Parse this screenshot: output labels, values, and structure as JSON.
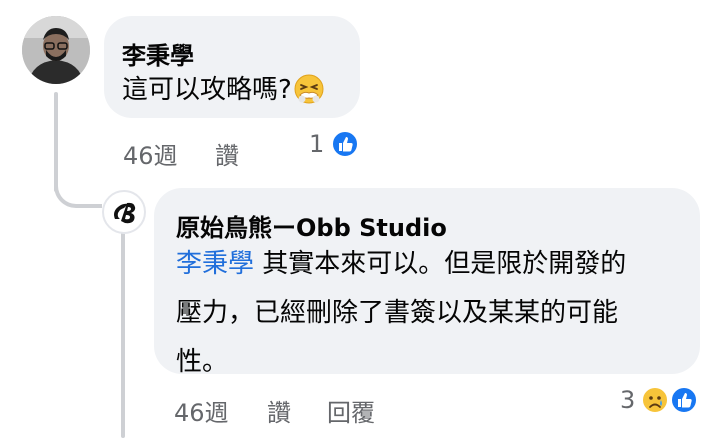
{
  "comment1": {
    "author": "李秉學",
    "text": "這可以攻略嗎?",
    "emoji": "tired-face-emoji",
    "time": "46週",
    "like_label": "讚",
    "reaction_count": "1",
    "reaction_icon": "like-icon"
  },
  "reply1": {
    "author": "原始鳥熊ーObb Studio",
    "mention": "李秉學",
    "text_line1": " 其實本來可以。但是限於開發的",
    "text_line2": "壓力，已經刪除了書簽以及某某的可能",
    "text_line3": "性。",
    "time": "46週",
    "like_label": "讚",
    "reply_label": "回覆",
    "reaction_count": "3",
    "reaction_icons": [
      "sad-icon",
      "like-icon"
    ]
  },
  "colors": {
    "bubble": "#f0f2f5",
    "mention": "#216fdb",
    "secondary_text": "#65676b",
    "like_blue": "#1877f2",
    "thread_line": "#ced0d4"
  }
}
